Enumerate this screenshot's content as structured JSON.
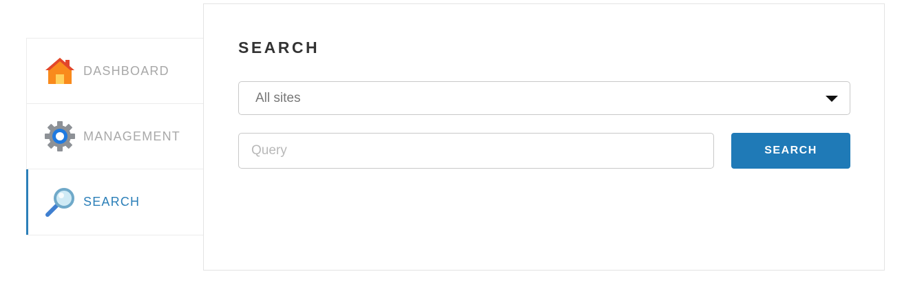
{
  "sidebar": {
    "items": [
      {
        "label": "DASHBOARD",
        "icon": "house-icon",
        "active": false
      },
      {
        "label": "MANAGEMENT",
        "icon": "gear-icon",
        "active": false
      },
      {
        "label": "SEARCH",
        "icon": "magnifier-icon",
        "active": true
      }
    ]
  },
  "panel": {
    "title": "SEARCH",
    "site_select": {
      "value": "All sites"
    },
    "query": {
      "value": "",
      "placeholder": "Query"
    },
    "search_button_label": "SEARCH"
  },
  "colors": {
    "accent": "#1f7ab7",
    "active_nav": "#2b7fb8",
    "inactive_nav": "#a8a8a8",
    "title": "#333333"
  }
}
